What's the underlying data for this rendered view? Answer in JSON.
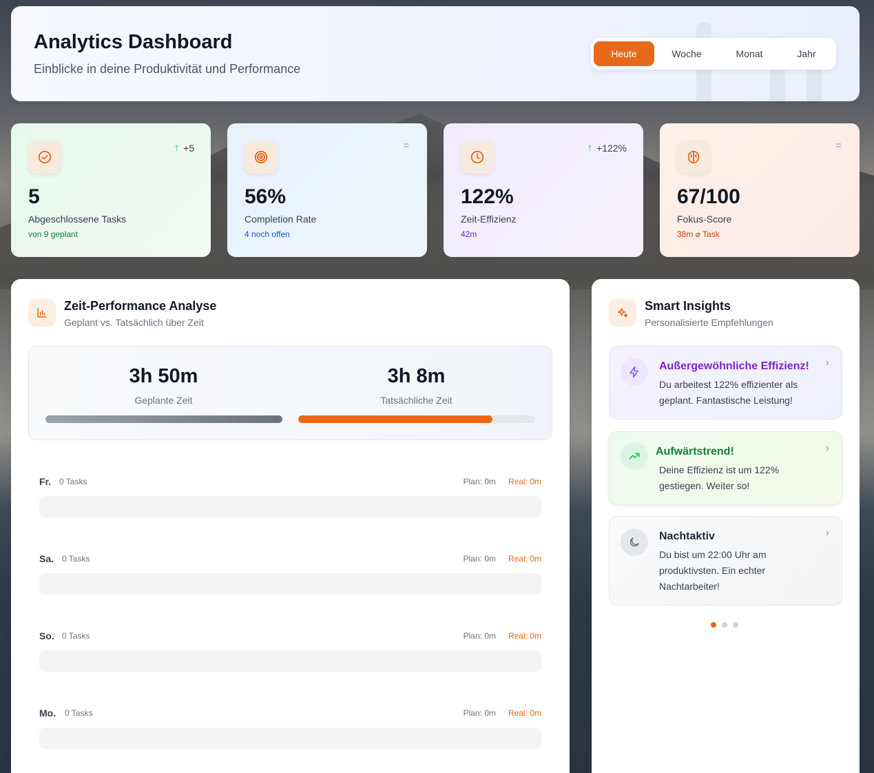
{
  "header": {
    "title": "Analytics Dashboard",
    "subtitle": "Einblicke in deine Produktivität und Performance",
    "periods": [
      "Heute",
      "Woche",
      "Monat",
      "Jahr"
    ],
    "active_period": "Heute"
  },
  "stats": [
    {
      "icon": "check-circle-icon",
      "trend": "+5",
      "trend_dir": "up",
      "value": "5",
      "label": "Abgeschlossene Tasks",
      "note": "von 9 geplant",
      "note_color": "#15803d",
      "bg": "#eaf7ee"
    },
    {
      "icon": "target-icon",
      "trend": "",
      "trend_dir": "flat",
      "value": "56%",
      "label": "Completion Rate",
      "note": "4 noch offen",
      "note_color": "#1d4ed8",
      "bg": "#eaf3fc"
    },
    {
      "icon": "clock-icon",
      "trend": "+122%",
      "trend_dir": "up",
      "value": "122%",
      "label": "Zeit-Effizienz",
      "note": "42m",
      "note_color": "#7e22ce",
      "bg": "#f3effd"
    },
    {
      "icon": "brain-icon",
      "trend": "",
      "trend_dir": "flat",
      "value": "67/100",
      "label": "Fokus-Score",
      "note": "38m ⌀ Task",
      "note_color": "#c2410c",
      "bg": "#fdefe8"
    }
  ],
  "performance": {
    "title": "Zeit-Performance Analyse",
    "subtitle": "Geplant vs. Tatsächlich über Zeit",
    "planned": {
      "value": "3h 50m",
      "label": "Geplante Zeit",
      "fill_pct": 100
    },
    "actual": {
      "value": "3h 8m",
      "label": "Tatsächliche Zeit",
      "fill_pct": 82
    },
    "days": [
      {
        "name": "Fr.",
        "tasks": "0 Tasks",
        "plan": "Plan: 0m",
        "real": "Real: 0m"
      },
      {
        "name": "Sa.",
        "tasks": "0 Tasks",
        "plan": "Plan: 0m",
        "real": "Real: 0m"
      },
      {
        "name": "So.",
        "tasks": "0 Tasks",
        "plan": "Plan: 0m",
        "real": "Real: 0m"
      },
      {
        "name": "Mo.",
        "tasks": "0 Tasks",
        "plan": "Plan: 0m",
        "real": "Real: 0m"
      }
    ]
  },
  "insights": {
    "title": "Smart Insights",
    "subtitle": "Personalisierte Empfehlungen",
    "items": [
      {
        "icon": "lightning-icon",
        "title": "Außergewöhnliche Effizienz!",
        "text": "Du arbeitest 122% effizienter als geplant. Fantastische Leistung!",
        "title_color": "#7e22ce"
      },
      {
        "icon": "trending-up-icon",
        "title": "Aufwärtstrend!",
        "text": "Deine Effizienz ist um 122% gestiegen. Weiter so!",
        "title_color": "#15803d"
      },
      {
        "icon": "moon-icon",
        "title": "Nachtaktiv",
        "text": "Du bist um 22:00 Uhr am produktivsten. Ein echter Nachtarbeiter!",
        "title_color": "#1f2937"
      }
    ],
    "pager": {
      "count": 3,
      "active": 0
    }
  },
  "colors": {
    "accent": "#e8681a",
    "planned_bar": "#6b7280",
    "trend_up": "#22c55e"
  }
}
